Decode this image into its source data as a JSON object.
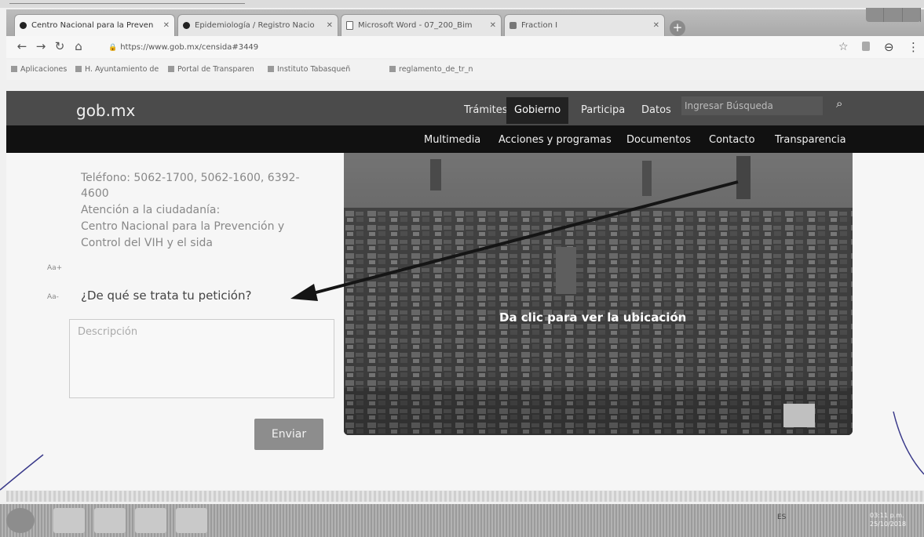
{
  "browser": {
    "tabs": [
      {
        "title": "Centro Nacional para la Preven",
        "active": true,
        "icon": "dot"
      },
      {
        "title": "Epidemiología / Registro Nacio",
        "active": false,
        "icon": "dot"
      },
      {
        "title": "Microsoft Word - 07_200_Bim",
        "active": false,
        "icon": "doc"
      },
      {
        "title": "Fraction I",
        "active": false,
        "icon": "app"
      }
    ],
    "url": "https://www.gob.mx/censida#3449",
    "bookmarks": [
      "Aplicaciones",
      "H. Ayuntamiento de",
      "Portal de Transparen",
      "Instituto Tabasqueñ",
      "reglamento_de_tr_n"
    ]
  },
  "site": {
    "logo": "gob.mx",
    "main_nav": [
      "Trámites",
      "Gobierno",
      "Participa",
      "Datos"
    ],
    "search_placeholder": "Ingresar Búsqueda",
    "sub_nav": [
      "Multimedia",
      "Acciones y programas",
      "Documentos",
      "Contacto",
      "Transparencia"
    ]
  },
  "content": {
    "info_lines": [
      "Teléfono: 5062-1700, 5062-1600, 6392-",
      "4600",
      "Atención a la ciudadanía:",
      "Centro Nacional para la Prevención y",
      "Control del VIH y el sida"
    ],
    "font_increase": "Aa+",
    "font_decrease": "Aa-",
    "question": "¿De qué se trata tu petición?",
    "description_placeholder": "Descripción",
    "submit_label": "Enviar",
    "map_label": "Da clic para ver la ubicación"
  },
  "taskbar": {
    "tray_lang": "ES",
    "time": "03:11 p.m.",
    "date": "25/10/2018"
  }
}
